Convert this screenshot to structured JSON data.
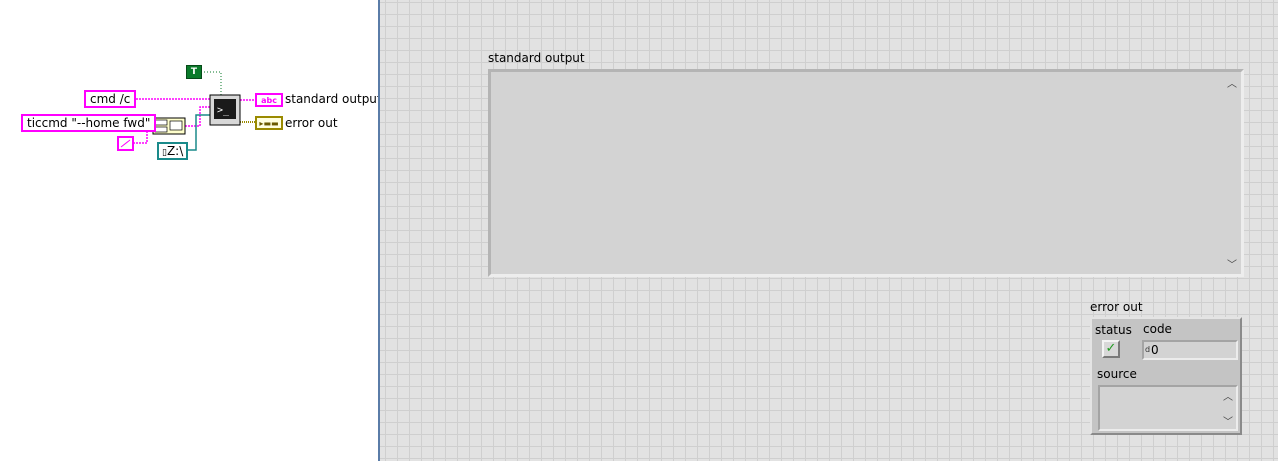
{
  "block_diagram": {
    "constants": {
      "cmd": "cmd /c",
      "ticcmd": "ticcmd \"--home fwd\"",
      "path": "Z:\\",
      "bool": "T"
    },
    "indicators": {
      "stdout_terminal_glyph": "abc",
      "stdout_label": "standard output",
      "error_label": "error out"
    },
    "node_icons": {
      "system_exec": "terminal-icon",
      "concatenate": "concatenate-strings-icon",
      "empty_string": "empty-string-icon"
    }
  },
  "front_panel": {
    "standard_output": {
      "label": "standard output",
      "value": ""
    },
    "error_out": {
      "label": "error out",
      "status_label": "status",
      "code_label": "code",
      "source_label": "source",
      "code_value": "0",
      "code_radix": "d",
      "source_value": ""
    }
  },
  "colors": {
    "string_wire": "#ff00ff",
    "path_wire": "#1a8a8a",
    "bool_wire": "#0a7a2a",
    "error_wire": "#9a8a00",
    "panel_border": "#5a7ca8"
  }
}
